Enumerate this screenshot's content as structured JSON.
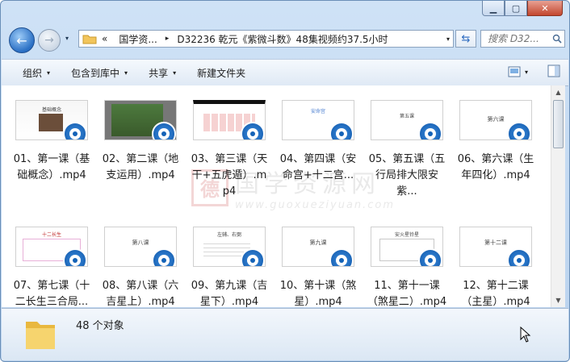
{
  "window": {
    "min_label": "▁",
    "max_label": "▢",
    "close_label": "✕"
  },
  "nav": {
    "back_icon": "arrow-left",
    "forward_icon": "arrow-right",
    "dropdown": "▾"
  },
  "address": {
    "chevrons": "«",
    "crumb1": "国学资...",
    "sep": "▸",
    "crumb2": "D32236 乾元《紫微斗数》48集视频约37.5小时",
    "dropdown": "▾"
  },
  "refresh_icon": "⇆",
  "search": {
    "placeholder": "搜索 D32..."
  },
  "toolbar": {
    "organize": "组织",
    "include_library": "包含到库中",
    "share": "共享",
    "new_folder": "新建文件夹",
    "arrow": "▾"
  },
  "files": [
    {
      "name": "01、第一课（基础概念）.mp4",
      "thumb_title": "基础概念"
    },
    {
      "name": "02、第二课（地支运用）.mp4",
      "thumb_title": ""
    },
    {
      "name": "03、第三课（天干+五虎遁）.mp4",
      "thumb_title": ""
    },
    {
      "name": "04、第四课（安命宫+十二宫...",
      "thumb_title": "安命宫"
    },
    {
      "name": "05、第五课（五行局排大限安紫...",
      "thumb_title": "第五课"
    },
    {
      "name": "06、第六课（生年四化）.mp4",
      "thumb_title": "第六课"
    },
    {
      "name": "07、第七课（十二长生三合局...",
      "thumb_title": "十二长生"
    },
    {
      "name": "08、第八课（六吉星上）.mp4",
      "thumb_title": "第八课"
    },
    {
      "name": "09、第九课（吉星下）.mp4",
      "thumb_title": "左辅、右弼"
    },
    {
      "name": "10、第十课（煞星）.mp4",
      "thumb_title": "第九课"
    },
    {
      "name": "11、第十一课（煞星二）.mp4",
      "thumb_title": "安火星铃星"
    },
    {
      "name": "12、第十二课（主星）.mp4",
      "thumb_title": "第十二课"
    }
  ],
  "watermark": {
    "seal": "德",
    "cn": "国学资源网",
    "url": "www.guoxueziyuan.com"
  },
  "status": {
    "count": "48 个对象"
  },
  "scrollbar": {
    "up": "▲",
    "down": "▼"
  }
}
